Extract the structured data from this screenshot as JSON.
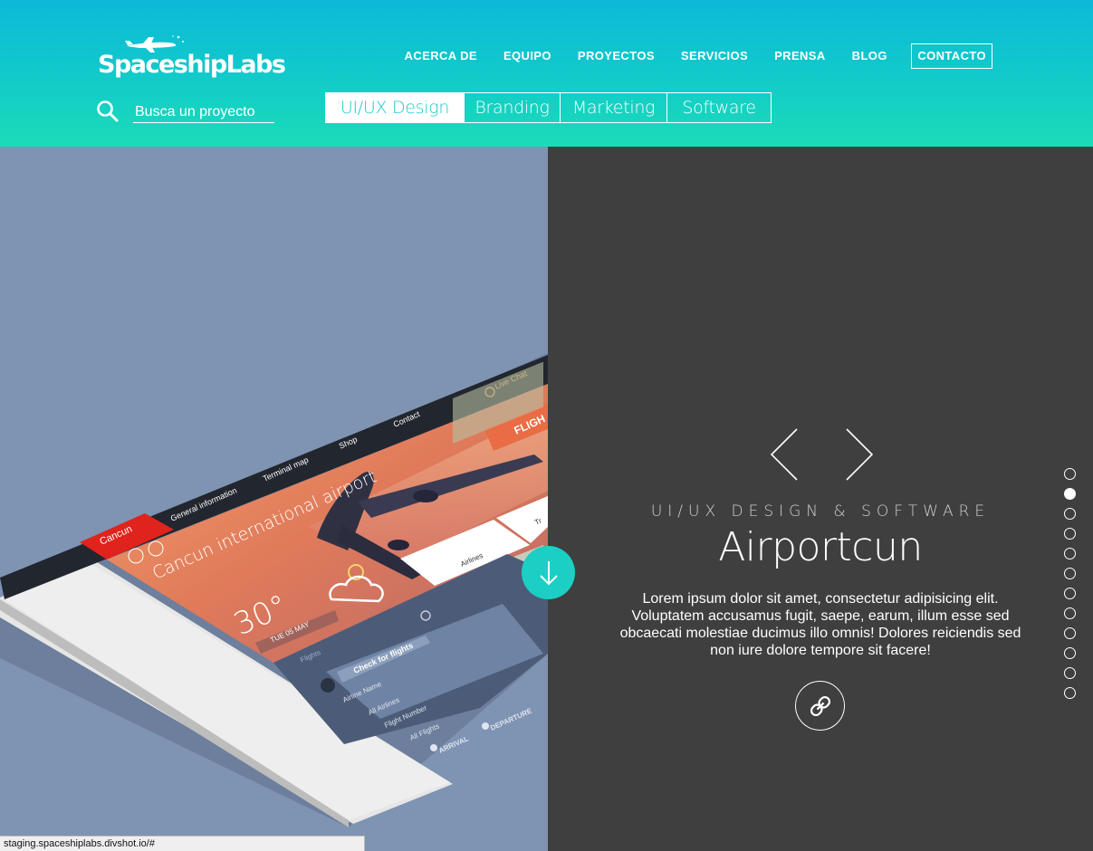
{
  "brand": {
    "name": "SpaceshipLabs"
  },
  "nav": {
    "items": [
      "ACERCA DE",
      "EQUIPO",
      "PROYECTOS",
      "SERVICIOS",
      "PRENSA",
      "BLOG"
    ],
    "contact": "CONTACTO"
  },
  "search": {
    "placeholder": "Busca un proyecto"
  },
  "tabs": [
    "UI/UX Design",
    "Branding",
    "Marketing",
    "Software"
  ],
  "project": {
    "category": "UI/UX DESIGN & SOFTWARE",
    "title": "Airportcun",
    "description": "Lorem ipsum dolor sit amet, consectetur adipisicing elit. Voluptatem accusamus fugit, saepe, earum, illum esse sed obcaecati molestiae ducimus illo omnis! Dolores reiciendis sed non iure dolore tempore sit facere!"
  },
  "mockup": {
    "brand": "Cancun",
    "menu": [
      "General information",
      "Terminal map",
      "Shop",
      "Contact"
    ],
    "live_chat": "Live Chat",
    "flights_tag": "FLIGH",
    "headline": "Cancun international airport",
    "temperature": "30°",
    "date": "TUE 05 MAY",
    "flights_label": "Flights",
    "check_flights": "Check for flights",
    "airline_name": "Airline Name",
    "all_airlines": "All Airlines",
    "flight_number": "Flight Number",
    "all_flights": "All Flights",
    "arrival": "ARRIVAL",
    "departure": "DEPARTURE",
    "airlines_tile": "Airlines",
    "tr_tile": "Tr"
  },
  "pager": {
    "count": 12,
    "active_index": 1
  },
  "status_bar": {
    "url": "staging.spaceshiplabs.divshot.io/#"
  },
  "colors": {
    "header_top": "#0cb9d9",
    "header_bottom": "#1bdcb8",
    "accent": "#1ccfc5",
    "left_bg": "#7f93b3",
    "right_bg": "#3f3f3f",
    "mockup_red": "#e0231c"
  },
  "icons": {
    "search": "search-icon",
    "logo_ship": "spaceship-icon",
    "prev": "chevron-left-icon",
    "next": "chevron-right-icon",
    "link": "link-icon",
    "scroll": "arrow-down-icon"
  }
}
